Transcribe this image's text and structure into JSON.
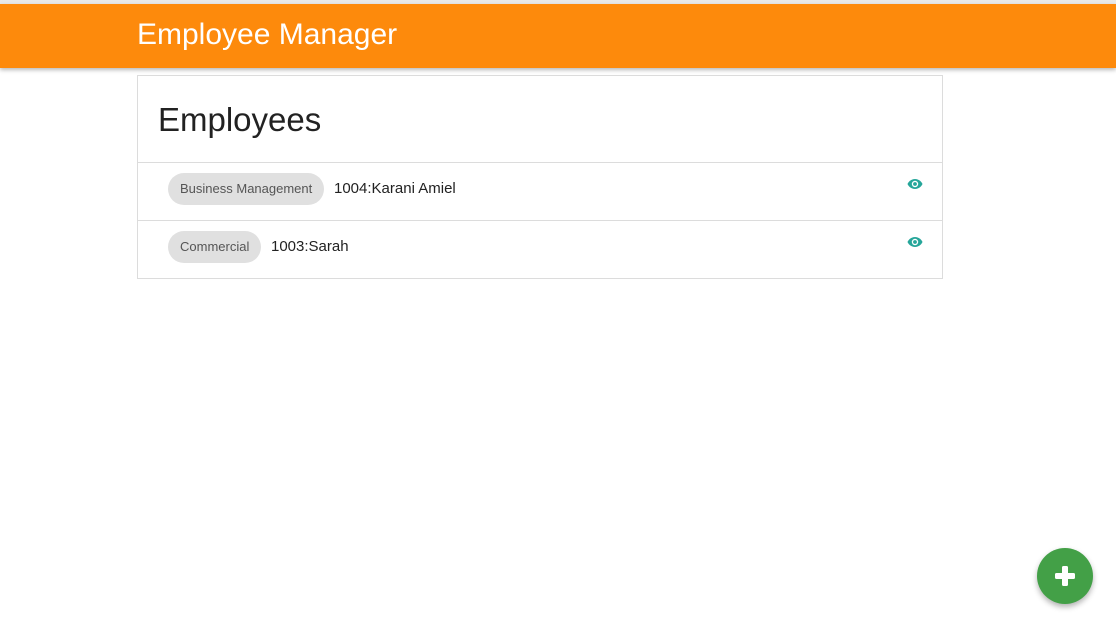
{
  "app_bar": {
    "title": "Employee Manager",
    "color": "#fd8a0c"
  },
  "card": {
    "title": "Employees"
  },
  "employees": [
    {
      "department": "Business Management",
      "label": "1004:Karani Amiel",
      "action_icon": "eye-icon"
    },
    {
      "department": "Commercial",
      "label": "1003:Sarah",
      "action_icon": "eye-icon"
    }
  ],
  "fab": {
    "icon": "plus-icon",
    "color": "#43a047"
  },
  "colors": {
    "eye_icon": "#26a69a",
    "chip_bg": "#e0e0e0"
  }
}
